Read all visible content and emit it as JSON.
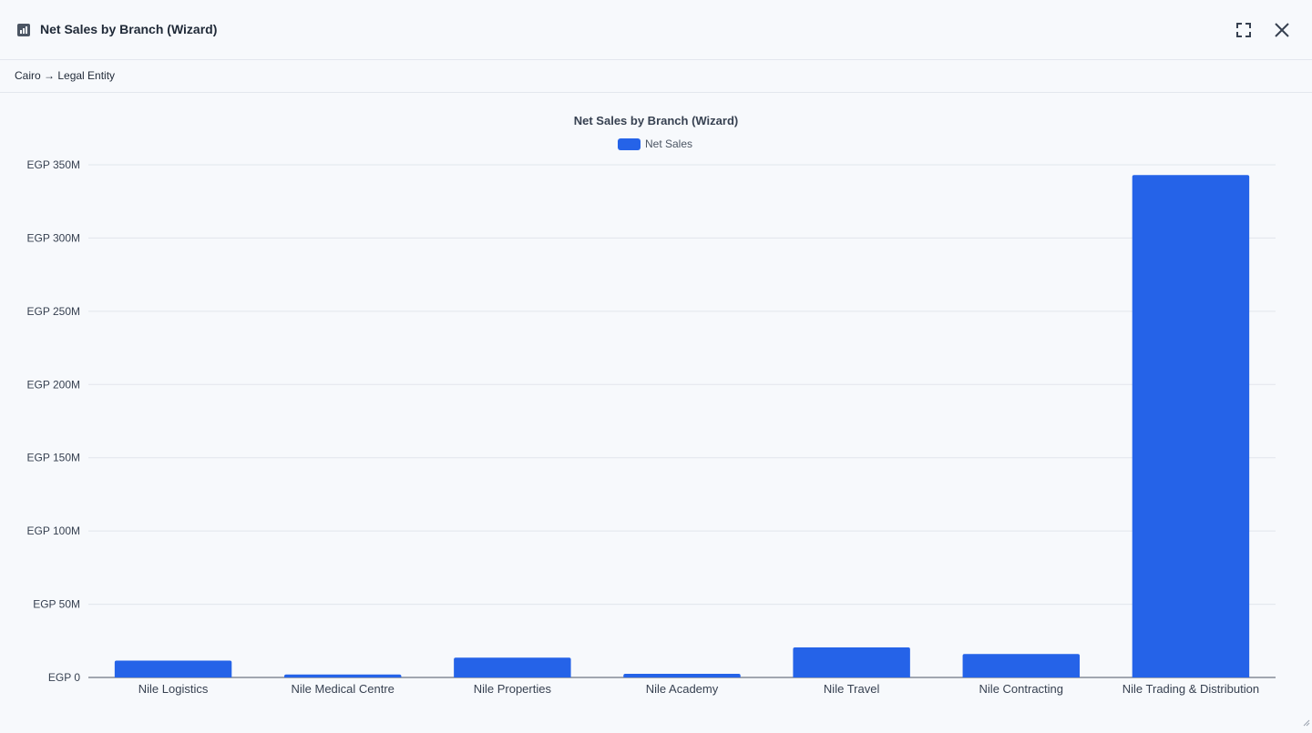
{
  "window": {
    "title": "Net Sales by Branch (Wizard)",
    "breadcrumb": "Cairo → Legal Entity"
  },
  "icons": {
    "title": "bar-chart-icon",
    "expand": "expand-icon",
    "close": "close-icon"
  },
  "colors": {
    "bar": "#2563e8",
    "grid": "#e2e6ec",
    "axis": "#4b5563",
    "text": "#374151"
  },
  "chart_data": {
    "type": "bar",
    "title": "Net Sales by Branch (Wizard)",
    "legend": {
      "position": "top-center",
      "entries": [
        "Net Sales"
      ]
    },
    "xlabel": "",
    "ylabel": "",
    "categories": [
      "Nile Logistics",
      "Nile Medical Centre",
      "Nile Properties",
      "Nile Academy",
      "Nile Travel",
      "Nile Contracting",
      "Nile Trading & Distribution"
    ],
    "series": [
      {
        "name": "Net Sales",
        "values": [
          11500000,
          2000000,
          13500000,
          2500000,
          20500000,
          16000000,
          343000000
        ]
      }
    ],
    "ylim": [
      0,
      350000000
    ],
    "yticks": [
      0,
      50000000,
      100000000,
      150000000,
      200000000,
      250000000,
      300000000,
      350000000
    ],
    "ytick_labels": [
      "EGP 0",
      "EGP 50M",
      "EGP 100M",
      "EGP 150M",
      "EGP 200M",
      "EGP 250M",
      "EGP 300M",
      "EGP 350M"
    ],
    "grid": true
  }
}
